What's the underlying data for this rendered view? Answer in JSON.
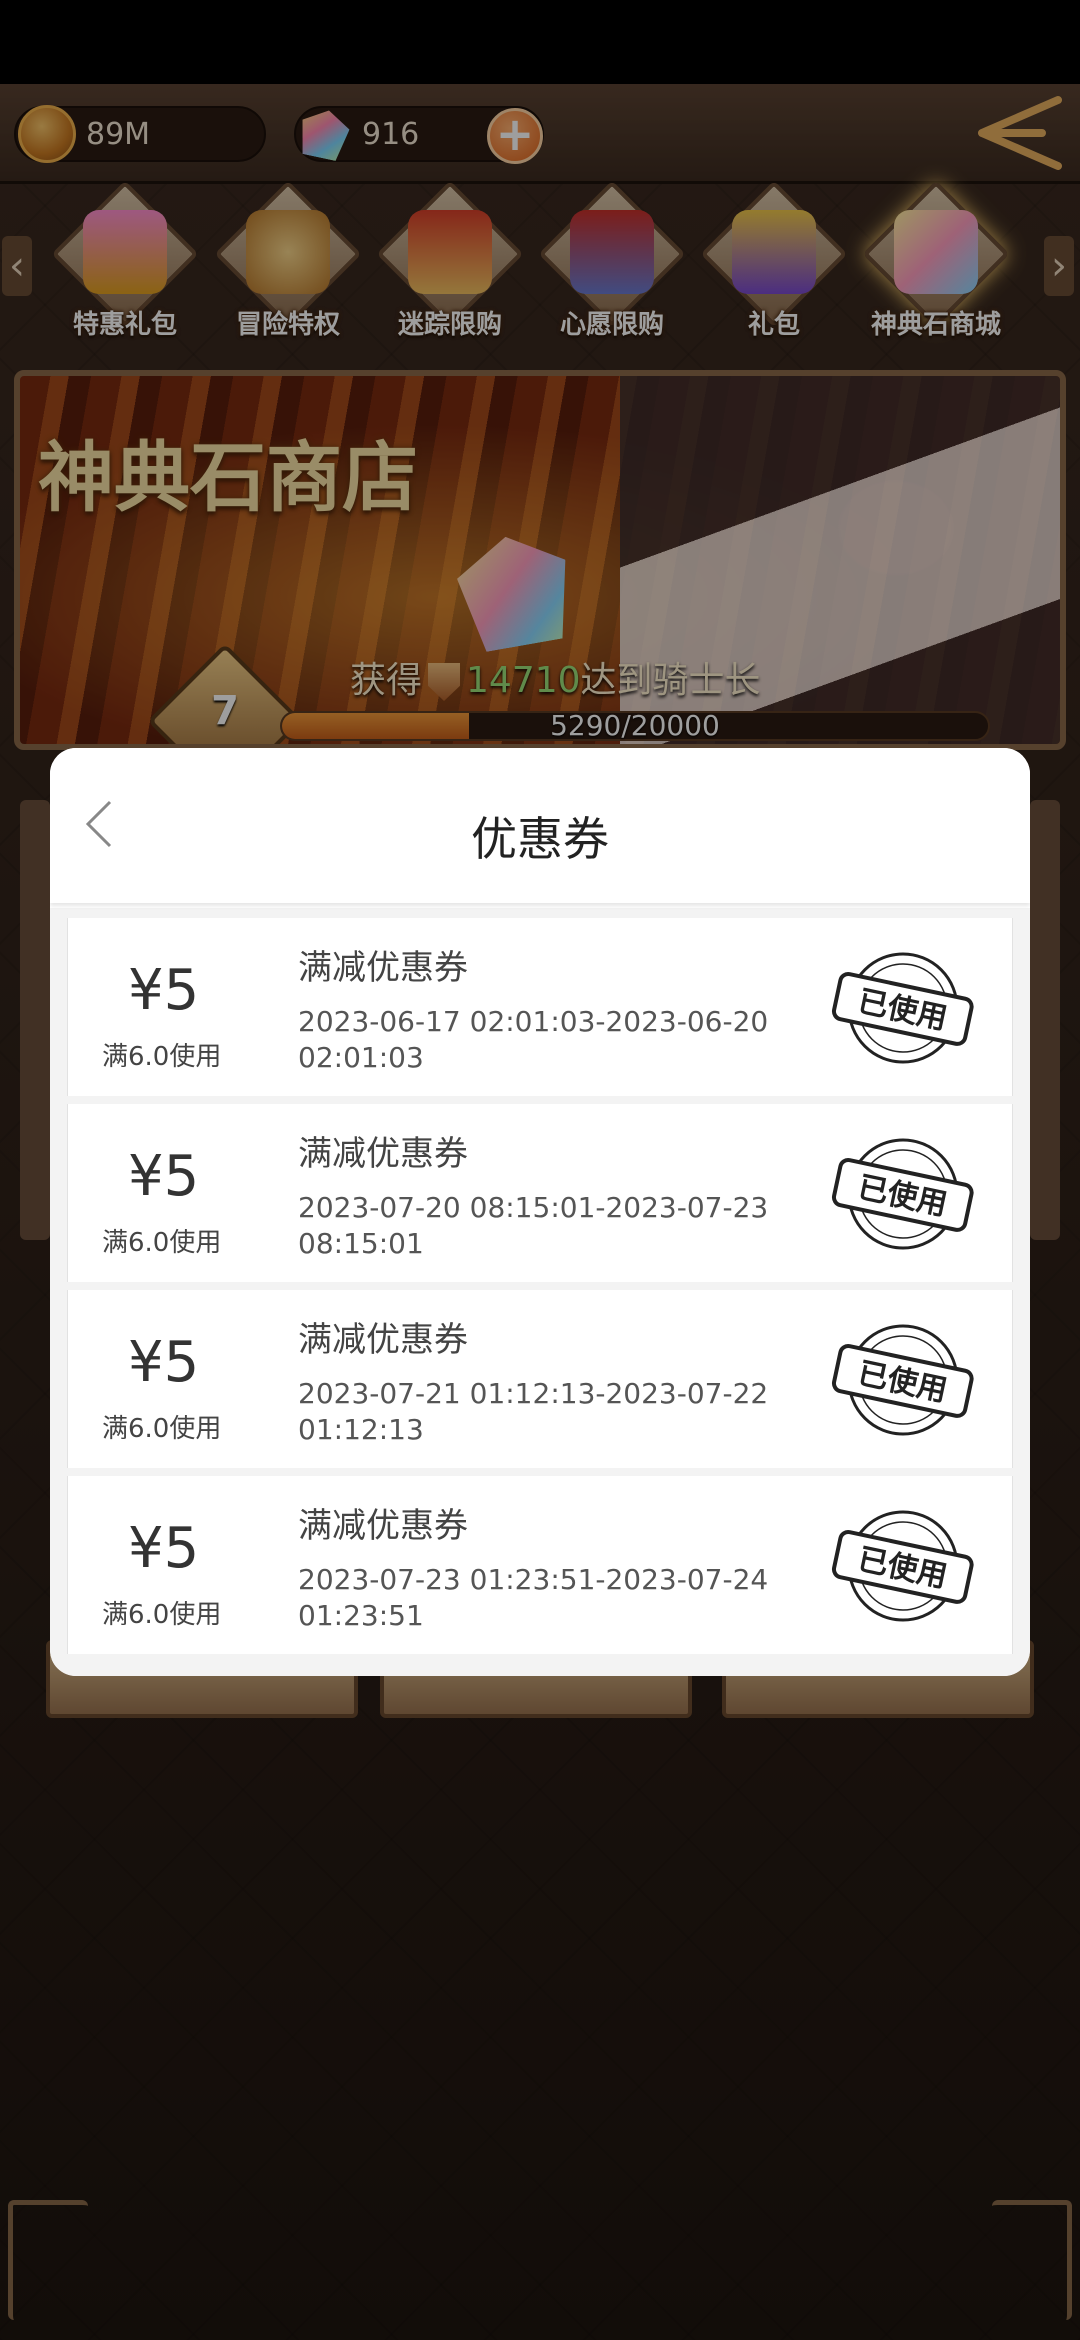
{
  "top_bar": {
    "coins": "89M",
    "gems": "916"
  },
  "tabs": [
    {
      "label": "特惠礼包",
      "icon": "gift-box-icon",
      "color": "#e66aa8"
    },
    {
      "label": "冒险特权",
      "icon": "medal-icon",
      "color": "#d89a3a"
    },
    {
      "label": "迷踪限购",
      "icon": "treasure-chest-icon",
      "color": "#c83a2a"
    },
    {
      "label": "心愿限购",
      "icon": "wish-chest-icon",
      "color": "#b83a2a"
    },
    {
      "label": "礼包",
      "icon": "crown-gift-icon",
      "color": "#8a5ad8"
    },
    {
      "label": "神典石商城",
      "icon": "gem-stone-icon",
      "color": "#f0b84a"
    }
  ],
  "banner": {
    "title": "神典石商店",
    "reward_prefix": "获得",
    "reward_amount": "14710",
    "reward_suffix": "达到骑士长",
    "level": "7",
    "progress_text": "5290/20000",
    "progress_fraction": 0.2645
  },
  "modal": {
    "title": "优惠券",
    "coupons": [
      {
        "amount": "¥5",
        "condition": "满6.0使用",
        "name": "满减优惠券",
        "period": "2023-06-17 02:01:03-2023-06-20 02:01:03",
        "status": "已使用"
      },
      {
        "amount": "¥5",
        "condition": "满6.0使用",
        "name": "满减优惠券",
        "period": "2023-07-20 08:15:01-2023-07-23 08:15:01",
        "status": "已使用"
      },
      {
        "amount": "¥5",
        "condition": "满6.0使用",
        "name": "满减优惠券",
        "period": "2023-07-21 01:12:13-2023-07-22 01:12:13",
        "status": "已使用"
      },
      {
        "amount": "¥5",
        "condition": "满6.0使用",
        "name": "满减优惠券",
        "period": "2023-07-23 01:23:51-2023-07-24 01:23:51",
        "status": "已使用"
      }
    ]
  },
  "colors": {
    "accent_orange": "#e0641c",
    "progress_fill": "#f29a3a",
    "reward_highlight": "#9be07a"
  }
}
